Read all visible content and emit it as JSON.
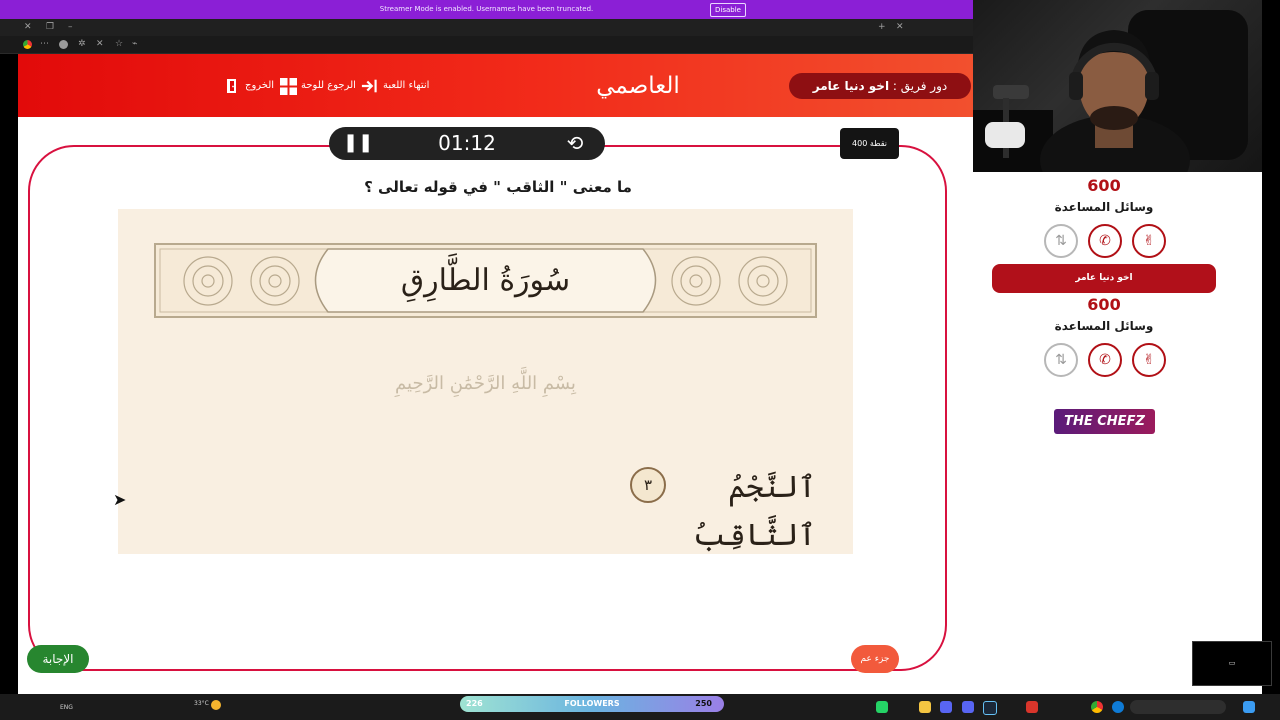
{
  "browser": {
    "streamer_notice": "Streamer Mode is enabled. Usernames have been truncated.",
    "disable_label": "Disable"
  },
  "header": {
    "brand": "العاصمي",
    "turn_prefix": "دور فريق :",
    "turn_team": "اخو دنيا عامر",
    "nav": {
      "end_game": "انتهاء اللعبة",
      "back_to_board": "الرجوع للوحة",
      "exit": "الخروج"
    }
  },
  "question": {
    "timer": "01:12",
    "points": "400 نقطة",
    "text": "ما معنى \" الثاقب \" في قوله تعالى ؟",
    "answer_label": "الإجابة",
    "category_label": "جزء عم",
    "image": {
      "surah_title": "سُورَةُ الطَّارِقِ",
      "basmala": "بِسْمِ اللَّهِ الرَّحْمَٰنِ الرَّحِيمِ",
      "ayah": "ٱلنَّجْمُ ٱلثَّاقِبُ",
      "ayah_number": "٣"
    }
  },
  "right_panel": {
    "team1": {
      "score": "600",
      "aids_title": "وسائل المساعدة"
    },
    "team2": {
      "name": "اخو دنيا عامر",
      "score": "600",
      "aids_title": "وسائل المساعدة"
    },
    "sponsor": "THE CHEFZ"
  },
  "taskbar": {
    "followers_label": "FOLLOWERS",
    "followers_current": "226",
    "followers_goal": "250",
    "language": "ENG",
    "temperature": "33°C"
  },
  "colors": {
    "header_red": "#e20a0a",
    "frame_red": "#d8113f",
    "answer_green": "#27862f",
    "team_maroon": "#8e0f12",
    "streamer_purple": "#8b1fd6"
  }
}
